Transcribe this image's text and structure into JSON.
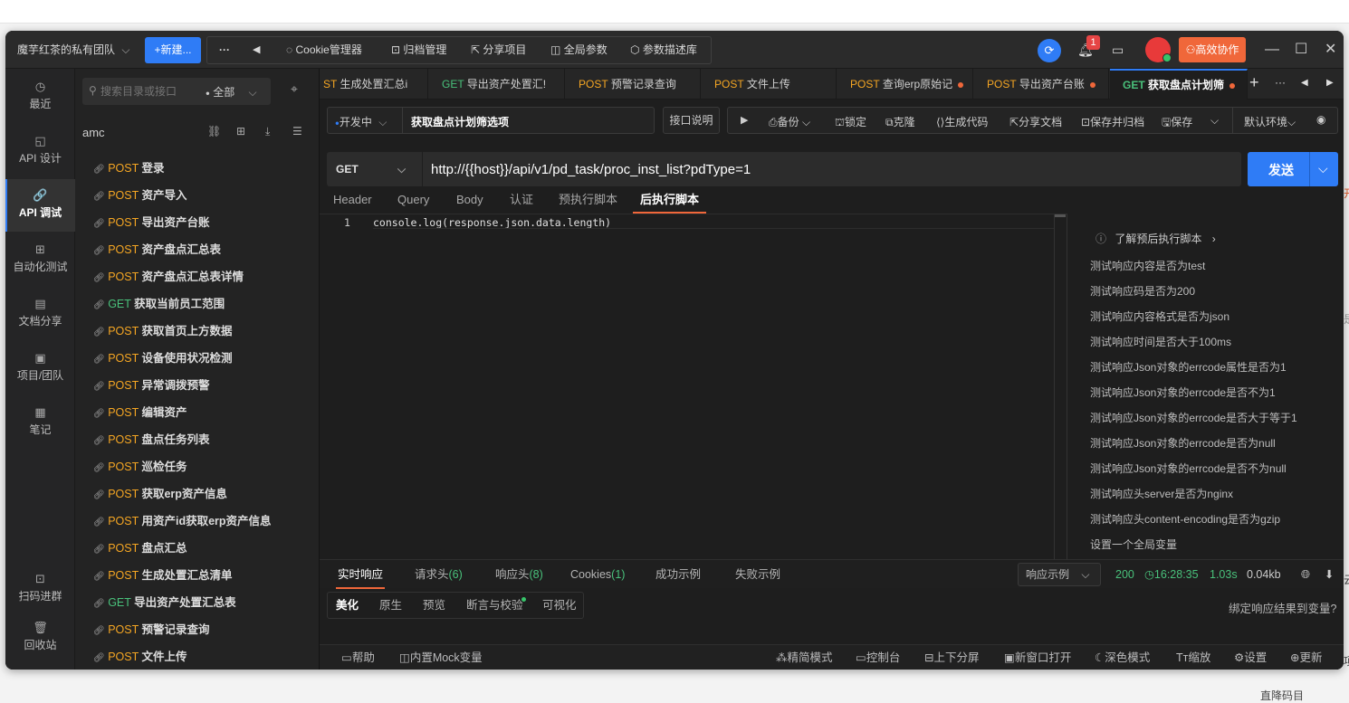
{
  "titlebar": {
    "team": "魔芋红茶的私有团队",
    "new_button": "+新建...",
    "more": "···",
    "back": "◀",
    "menu": [
      "Cookie管理器",
      "归档管理",
      "分享项目",
      "全局参数",
      "参数描述库"
    ],
    "notification_count": "1",
    "collab_button": "高效协作"
  },
  "nav": {
    "items": [
      {
        "label": "最近",
        "icon": "clock-icon",
        "glyph": "◷"
      },
      {
        "label": "API 设计",
        "icon": "api-design-icon",
        "glyph": "◱"
      },
      {
        "label": "API 调试",
        "icon": "link-icon",
        "glyph": "🔗"
      },
      {
        "label": "自动化测试",
        "icon": "automation-icon",
        "glyph": "⊞"
      },
      {
        "label": "文档分享",
        "icon": "doc-share-icon",
        "glyph": "▤"
      },
      {
        "label": "项目/团队",
        "icon": "project-icon",
        "glyph": "▣"
      },
      {
        "label": "笔记",
        "icon": "note-icon",
        "glyph": "▦"
      }
    ],
    "bottom": [
      {
        "label": "扫码进群",
        "icon": "qr-icon",
        "glyph": "⊡"
      },
      {
        "label": "回收站",
        "icon": "trash-icon",
        "glyph": "🗑"
      }
    ]
  },
  "tree": {
    "search_placeholder": "搜索目录或接口",
    "filter": "全部",
    "project": "amc",
    "items": [
      {
        "method": "POST",
        "name": "登录"
      },
      {
        "method": "POST",
        "name": "资产导入"
      },
      {
        "method": "POST",
        "name": "导出资产台账"
      },
      {
        "method": "POST",
        "name": "资产盘点汇总表"
      },
      {
        "method": "POST",
        "name": "资产盘点汇总表详情"
      },
      {
        "method": "GET",
        "name": "获取当前员工范围"
      },
      {
        "method": "POST",
        "name": "获取首页上方数据"
      },
      {
        "method": "POST",
        "name": "设备使用状况检测"
      },
      {
        "method": "POST",
        "name": "异常调拨预警"
      },
      {
        "method": "POST",
        "name": "编辑资产"
      },
      {
        "method": "POST",
        "name": "盘点任务列表"
      },
      {
        "method": "POST",
        "name": "巡检任务"
      },
      {
        "method": "POST",
        "name": "获取erp资产信息"
      },
      {
        "method": "POST",
        "name": "用资产id获取erp资产信息"
      },
      {
        "method": "POST",
        "name": "盘点汇总"
      },
      {
        "method": "POST",
        "name": "生成处置汇总清单"
      },
      {
        "method": "GET",
        "name": "导出资产处置汇总表"
      },
      {
        "method": "POST",
        "name": "预警记录查询"
      },
      {
        "method": "POST",
        "name": "文件上传"
      }
    ]
  },
  "tabs": [
    {
      "method": "ST",
      "name": "生成处置汇总i",
      "dirty": false
    },
    {
      "method": "GET",
      "name": "导出资产处置汇!",
      "dirty": false
    },
    {
      "method": "POST",
      "name": "预警记录查询",
      "dirty": false
    },
    {
      "method": "POST",
      "name": "文件上传",
      "dirty": false
    },
    {
      "method": "POST",
      "name": "查询erp原始记",
      "dirty": true
    },
    {
      "method": "POST",
      "name": "导出资产台账",
      "dirty": true
    },
    {
      "method": "GET",
      "name": "获取盘点计划筛",
      "dirty": true
    }
  ],
  "request": {
    "env_status": "开发中",
    "name": "获取盘点计划筛选项",
    "doc_button": "接口说明",
    "actions": [
      "备份",
      "锁定",
      "克隆",
      "生成代码",
      "分享文档",
      "保存并归档",
      "保存"
    ],
    "environment": "默认环境",
    "method": "GET",
    "url": "http://{{host}}/api/v1/pd_task/proc_inst_list?pdType=1",
    "send": "发送"
  },
  "subtabs": [
    "Header",
    "Query",
    "Body",
    "认证",
    "预执行脚本",
    "后执行脚本"
  ],
  "editor": {
    "line_no": "1",
    "code": "console.log(response.json.data.length)"
  },
  "snippets": {
    "header": "了解预后执行脚本",
    "items": [
      "测试响应内容是否为test",
      "测试响应码是否为200",
      "测试响应内容格式是否为json",
      "测试响应时间是否大于100ms",
      "测试响应Json对象的errcode属性是否为1",
      "测试响应Json对象的errcode是否不为1",
      "测试响应Json对象的errcode是否大于等于1",
      "测试响应Json对象的errcode是否为null",
      "测试响应Json对象的errcode是否不为null",
      "测试响应头server是否为nginx",
      "测试响应头content-encoding是否为gzip",
      "设置一个全局变量"
    ]
  },
  "response": {
    "tabs": [
      {
        "label": "实时响应",
        "count": ""
      },
      {
        "label": "请求头",
        "count": "(6)"
      },
      {
        "label": "响应头",
        "count": "(8)"
      },
      {
        "label": "Cookies",
        "count": "(1)"
      },
      {
        "label": "成功示例",
        "count": ""
      },
      {
        "label": "失败示例",
        "count": ""
      }
    ],
    "example_dropdown": "响应示例",
    "status": "200",
    "time": "16:28:35",
    "duration": "1.03s",
    "size": "0.04kb",
    "view_tabs": [
      "美化",
      "原生",
      "预览",
      "断言与校验",
      "可视化"
    ],
    "bind_text": "绑定响应结果到变量?"
  },
  "footer": {
    "left": [
      "帮助",
      "内置Mock变量"
    ],
    "right": [
      "精简模式",
      "控制台",
      "上下分屏",
      "新窗口打开",
      "深色模式",
      "缩放",
      "设置",
      "更新"
    ]
  },
  "background": {
    "right_edge": [
      "开",
      "是",
      "云",
      "项"
    ],
    "bottom_right": "直降码目"
  }
}
